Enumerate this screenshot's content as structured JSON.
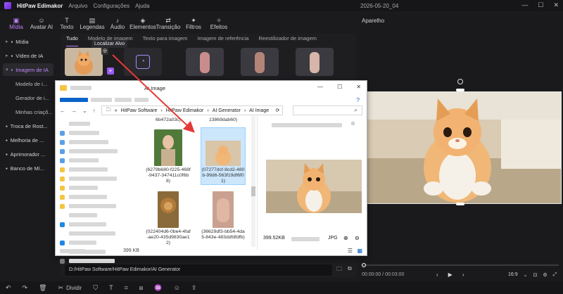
{
  "app": {
    "title": "HitPaw Edimakor",
    "menu": [
      "Arquivo",
      "Configurações",
      "Ajuda"
    ],
    "date": "2026-05-20_04"
  },
  "toolbar": [
    {
      "label": "Mídia",
      "icon": "media-icon",
      "glyph": "▣"
    },
    {
      "label": "Avatar AI",
      "icon": "avatar-icon",
      "glyph": "☺"
    },
    {
      "label": "Texto",
      "icon": "text-icon",
      "glyph": "T"
    },
    {
      "label": "Legendas",
      "icon": "subtitles-icon",
      "glyph": "▤"
    },
    {
      "label": "Áudio",
      "icon": "audio-icon",
      "glyph": "♪"
    },
    {
      "label": "Elementos",
      "icon": "elements-icon",
      "glyph": "◈"
    },
    {
      "label": "Transição",
      "icon": "transition-icon",
      "glyph": "⇄"
    },
    {
      "label": "Filtros",
      "icon": "filters-icon",
      "glyph": "✦"
    },
    {
      "label": "Efeitos",
      "icon": "effects-icon",
      "glyph": "✧"
    }
  ],
  "sidebar": [
    {
      "label": "Mídia",
      "type": "top"
    },
    {
      "label": "Vídeo de IA",
      "type": "top"
    },
    {
      "label": "Imagem de IA",
      "type": "top-open"
    },
    {
      "label": "Modelo de i...",
      "type": "sub"
    },
    {
      "label": "Gerador de i...",
      "type": "sub"
    },
    {
      "label": "Minhas criaçõ...",
      "type": "sub-sel"
    },
    {
      "label": "Troca de Rost...",
      "type": "icon"
    },
    {
      "label": "Melhoria de ...",
      "type": "icon"
    },
    {
      "label": "Aprimorador ...",
      "type": "icon"
    },
    {
      "label": "Banco de Mí...",
      "type": "icon"
    }
  ],
  "subtabs": [
    "Tudo",
    "Modelo de imagem",
    "Texto para imagem",
    "Imagem de referência",
    "Reestilizador de imagem"
  ],
  "tooltip": "Localizar Alvo",
  "right_panel": {
    "title": "Aparelho",
    "time_current": "00:00:00",
    "time_total": "00:03:00",
    "ratio": "16:9"
  },
  "path": "D:/HitPaw Software/HitPaw Edimakor/AI Generator",
  "explorer": {
    "title": "AI Image",
    "breadcrumb": [
      "HitPaw Software",
      "HitPaw Edimakor",
      "AI Generator",
      "AI Image"
    ],
    "files": [
      {
        "label": "6b472a03c)",
        "thumb": ""
      },
      {
        "label": "13869dab60)",
        "thumb": ""
      },
      {
        "label": "(6279b680-f225-468f-9437-347411c0f6b8)",
        "thumb": "woman"
      },
      {
        "label": "(07277dcf-8cd2-480b-99d6-563f19df6f01)",
        "thumb": "cat",
        "selected": true
      },
      {
        "label": "(022404d6-0be4-4faf-ae20-435d9830ae12)",
        "thumb": "lion"
      },
      {
        "label": "(36629df3-bb54-4da5-843e-483ddfdfdfb)",
        "thumb": "hand"
      }
    ],
    "status_size": "399 KB",
    "preview_size": "399.52KB",
    "preview_type": "JPG"
  }
}
